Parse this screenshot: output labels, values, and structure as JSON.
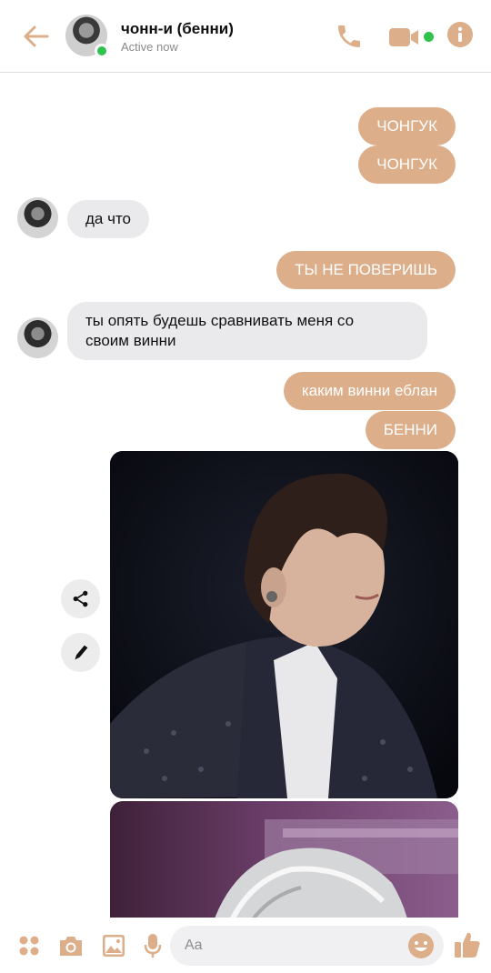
{
  "header": {
    "contact_name": "чонн-и (бенни)",
    "status": "Active now"
  },
  "messages": {
    "m1": "ЧОНГУК",
    "m2": "ЧОНГУК",
    "m3": "да что",
    "m4": "ТЫ НЕ ПОВЕРИШЬ",
    "m5_line1": "ты опять будешь сравнивать меня со",
    "m5_line2": "своим винни",
    "m6": "каким винни еблан",
    "m7": "БЕННИ"
  },
  "composer": {
    "placeholder": "Aa"
  },
  "colors": {
    "accent": "#dcae8a",
    "incoming_bubble": "#eaeaec",
    "online": "#31c24d"
  },
  "icons": [
    "back-arrow-icon",
    "phone-icon",
    "video-camera-icon",
    "info-icon",
    "share-icon",
    "edit-pencil-icon",
    "apps-grid-icon",
    "camera-icon",
    "gallery-icon",
    "microphone-icon",
    "emoji-icon",
    "thumbs-up-icon"
  ]
}
